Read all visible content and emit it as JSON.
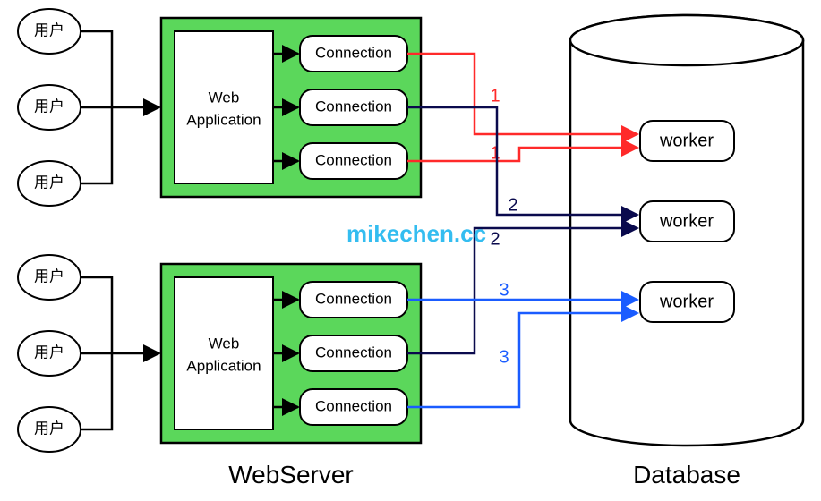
{
  "users_top": [
    "用户",
    "用户",
    "用户"
  ],
  "users_bottom": [
    "用户",
    "用户",
    "用户"
  ],
  "servers": [
    {
      "app_label_line1": "Web",
      "app_label_line2": "Application",
      "connections": [
        "Connection",
        "Connection",
        "Connection"
      ]
    },
    {
      "app_label_line1": "Web",
      "app_label_line2": "Application",
      "connections": [
        "Connection",
        "Connection",
        "Connection"
      ]
    }
  ],
  "database": {
    "workers": [
      "worker",
      "worker",
      "worker"
    ]
  },
  "edge_labels": {
    "red_top": "1",
    "red_bottom": "1",
    "navy_top": "2",
    "navy_bottom": "2",
    "blue_top": "3",
    "blue_bottom": "3"
  },
  "labels": {
    "webserver": "WebServer",
    "database": "Database"
  },
  "watermark": "mikechen.cc",
  "colors": {
    "server_bg": "#5bd75b",
    "line_red": "#ff2a2a",
    "line_navy": "#0a0a4d",
    "line_blue": "#1a5cff",
    "watermark": "#34bdf0"
  }
}
